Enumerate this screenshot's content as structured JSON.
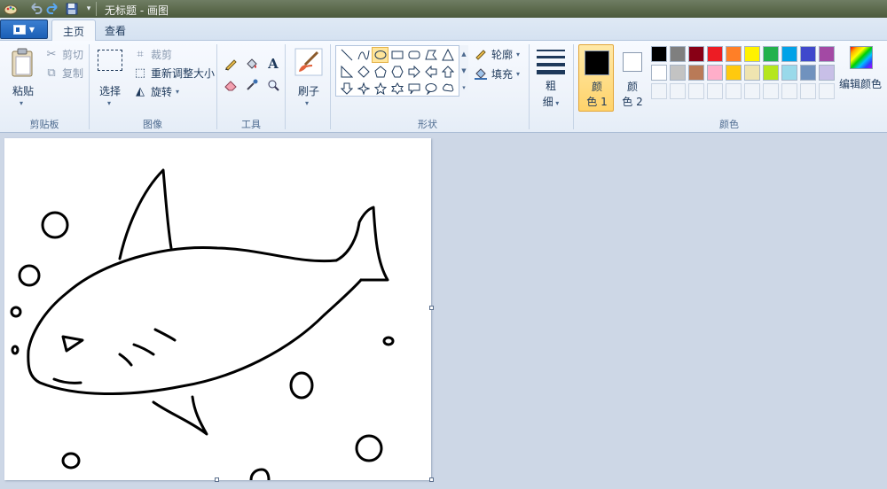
{
  "titlebar": {
    "title": "无标题 - 画图",
    "quick_access": [
      "paint-app-icon",
      "undo-icon",
      "redo-icon",
      "save-icon",
      "customize-dropdown-icon"
    ]
  },
  "tabs": {
    "home": "主页",
    "view": "查看"
  },
  "clipboard": {
    "paste": "粘贴",
    "cut": "剪切",
    "copy": "复制",
    "group_label": "剪贴板"
  },
  "image": {
    "select": "选择",
    "crop": "裁剪",
    "resize": "重新调整大小",
    "rotate": "旋转",
    "group_label": "图像"
  },
  "tools": {
    "group_label": "工具",
    "text_glyph": "A"
  },
  "brushes": {
    "label": "刷子"
  },
  "shapes": {
    "outline": "轮廓",
    "fill": "填充",
    "group_label": "形状"
  },
  "size": {
    "label_line1": "粗",
    "label_line2": "细"
  },
  "colors": {
    "color1_line1": "颜",
    "color1_line2": "色 1",
    "color2_line1": "颜",
    "color2_line2": "色 2",
    "color1_value": "#000000",
    "color2_value": "#ffffff",
    "edit_colors": "编辑颜色",
    "group_label": "颜色",
    "palette_row1": [
      "#000000",
      "#7f7f7f",
      "#880015",
      "#ed1c24",
      "#ff7f27",
      "#fff200",
      "#22b14c",
      "#00a2e8",
      "#3f48cc",
      "#a349a4"
    ],
    "palette_row2": [
      "#ffffff",
      "#c3c3c3",
      "#b97a57",
      "#ffaec9",
      "#ffc90e",
      "#efe4b0",
      "#b5e61d",
      "#99d9ea",
      "#7092be",
      "#c8bfe7"
    ]
  },
  "canvas": {
    "background": "#ffffff",
    "stroke_color": "#000000",
    "drawing": "shark-with-bubbles"
  },
  "workspace_color": "#cdd7e6"
}
